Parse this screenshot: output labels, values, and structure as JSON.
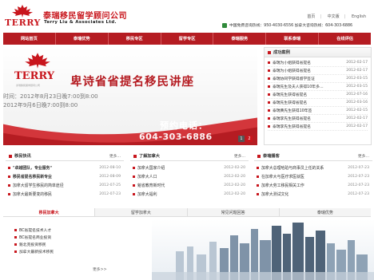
{
  "header": {
    "logo_text": "TERRY",
    "company_cn": "泰瑞移民留学顾问公司",
    "company_en": "Terry Liu & Associates Ltd.",
    "links": [
      "首页",
      "中文版",
      "English"
    ],
    "hotline": "中国免费咨询热线：950-4030-6556  加拿大咨询热线：604-303-6886"
  },
  "nav": [
    "网站首页",
    "泰瑞优势",
    "移民专区",
    "留学专区",
    "泰瑞服务",
    "联系泰瑞",
    "在线评估"
  ],
  "banner": {
    "logo_text": "TERRY",
    "logo_sub": "泰瑞移民留学顾问公司",
    "title": "卑诗省省提名移民讲座",
    "time1": "时间：2012年8月23日晚7:00到8:00",
    "time2": "2012年9月6日晚7:00到8:00",
    "cta": "预约电话：",
    "phone": "604-303-6886",
    "pager": [
      "1",
      "2"
    ]
  },
  "success": {
    "title": "成功案例",
    "items": [
      {
        "text": "泰瑞为小姐获得省提名",
        "date": "2012-02-17"
      },
      {
        "text": "泰瑞为小姐获得省提名",
        "date": "2012-02-17"
      },
      {
        "text": "泰瑞协同学获得留学签证",
        "date": "2012-03-15"
      },
      {
        "text": "泰瑞先生及夫人获得10年多…",
        "date": "2012-03-15"
      },
      {
        "text": "泰瑞先生获得省提名",
        "date": "2012-07-16"
      },
      {
        "text": "泰瑞先生获得省提名",
        "date": "2012-03-16"
      },
      {
        "text": "泰瑞黄先生获得10年签",
        "date": "2012-02-15"
      },
      {
        "text": "泰瑞李先生获得省提名",
        "date": "2012-02-17"
      },
      {
        "text": "泰瑞李先生获得省提名",
        "date": "2012-02-17"
      }
    ]
  },
  "columns": [
    {
      "title": "移民快讯",
      "more": "更多...",
      "items": [
        {
          "text": "\"卓越团队，专业服务\"",
          "date": "2012-08-10"
        },
        {
          "text": "移民省提名移民新专业",
          "date": "2012-08-09"
        },
        {
          "text": "加拿大留学生移民的简单途径",
          "date": "2012-07-25"
        },
        {
          "text": "加拿大最新要变的移民",
          "date": "2012-07-23"
        }
      ]
    },
    {
      "title": "了解加拿大",
      "more": "更多...",
      "items": [
        {
          "text": "加拿大国家介绍",
          "date": "2012-02-20"
        },
        {
          "text": "加拿大人口",
          "date": "2012-02-20"
        },
        {
          "text": "魁省教育新时代",
          "date": "2012-02-20"
        },
        {
          "text": "加拿大福利",
          "date": "2012-02-20"
        }
      ]
    },
    {
      "title": "泰瑞播客",
      "more": "更多...",
      "items": [
        {
          "text": "加拿大总理哈珀与商事员上任的关系",
          "date": "2012-07-23"
        },
        {
          "text": "在加拿大与医疗求医就医",
          "date": "2012-07-23"
        },
        {
          "text": "加拿大劳工移民相关工作",
          "date": "2012-07-23"
        },
        {
          "text": "加拿大测试文化",
          "date": "2012-07-23"
        }
      ]
    }
  ],
  "tabs": [
    "移民加拿大",
    "留学加拿大",
    "常见问题回答",
    "泰瑞优势"
  ],
  "bottom": {
    "items": [
      "BC省提名技术人才",
      "BC省提名商业投资",
      "魁北克投资移民",
      "加拿大最新技术移民"
    ],
    "more": "更多>>"
  },
  "colors": {
    "brand_red": "#c8161d",
    "nav_red": "#b51c22"
  }
}
